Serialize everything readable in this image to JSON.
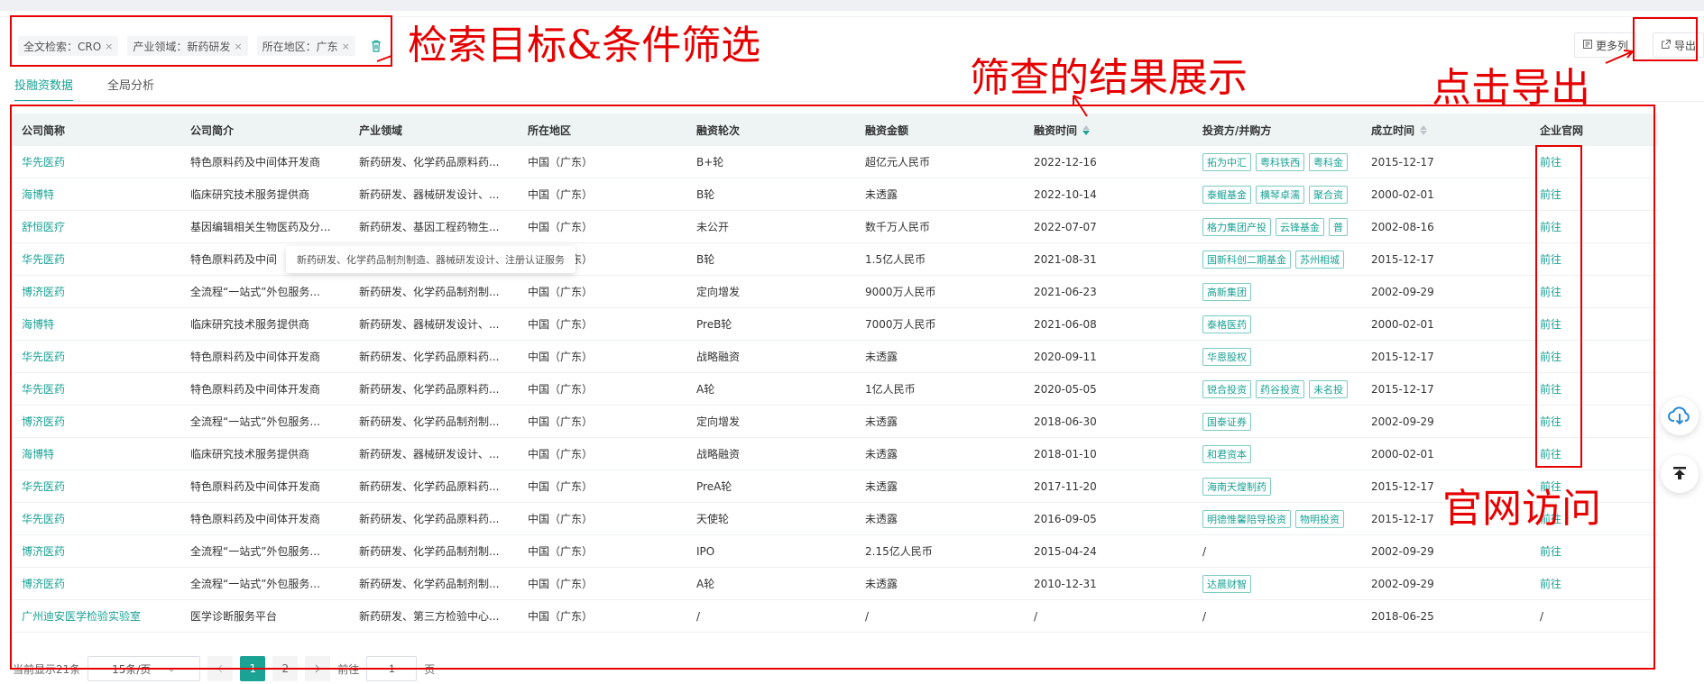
{
  "filters": [
    {
      "label": "全文检索：CRO"
    },
    {
      "label": "产业领域：新药研发"
    },
    {
      "label": "所在地区：广东"
    }
  ],
  "filter_close_glyph": "×",
  "toolbar": {
    "more_columns": "更多列",
    "export": "导出"
  },
  "tabs": [
    {
      "label": "投融资数据",
      "active": true
    },
    {
      "label": "全局分析",
      "active": false
    }
  ],
  "table": {
    "columns": [
      "公司简称",
      "公司简介",
      "产业领域",
      "所在地区",
      "融资轮次",
      "融资金额",
      "融资时间",
      "投资方/并购方",
      "成立时间",
      "企业官网"
    ],
    "rows": [
      {
        "name": "华先医药",
        "intro": "特色原料药及中间体开发商",
        "field": "新药研发、化学药品原料药...",
        "region": "中国（广东）",
        "round": "B+轮",
        "amount": "超亿元人民币",
        "date": "2022-12-16",
        "investors": [
          "拓为中汇",
          "粤科铁西",
          "粤科金"
        ],
        "founded": "2015-12-17",
        "site": "前往"
      },
      {
        "name": "海博特",
        "intro": "临床研究技术服务提供商",
        "field": "新药研发、器械研发设计、...",
        "region": "中国（广东）",
        "round": "B轮",
        "amount": "未透露",
        "date": "2022-10-14",
        "investors": [
          "泰鲲基金",
          "横琴卓濡",
          "聚合资"
        ],
        "founded": "2000-02-01",
        "site": "前往"
      },
      {
        "name": "舒恒医疗",
        "intro": "基因编辑相关生物医药及分...",
        "field": "新药研发、基因工程药物生...",
        "region": "中国（广东）",
        "round": "未公开",
        "amount": "数千万人民币",
        "date": "2022-07-07",
        "investors": [
          "格力集团产投",
          "云锋基金",
          "普"
        ],
        "founded": "2002-08-16",
        "site": "前往"
      },
      {
        "name": "华先医药",
        "intro": "特色原料药及中间",
        "field": "新药研发、化学药品原料药...",
        "region": "中国（广东）",
        "round": "B轮",
        "amount": "1.5亿人民币",
        "date": "2021-08-31",
        "investors": [
          "国新科创二期基金",
          "苏州相城"
        ],
        "founded": "2015-12-17",
        "site": "前往"
      },
      {
        "name": "博济医药",
        "intro": "全流程“一站式”外包服务...",
        "field": "新药研发、化学药品制剂制...",
        "region": "中国（广东）",
        "round": "定向增发",
        "amount": "9000万人民币",
        "date": "2021-06-23",
        "investors": [
          "高新集团"
        ],
        "founded": "2002-09-29",
        "site": "前往"
      },
      {
        "name": "海博特",
        "intro": "临床研究技术服务提供商",
        "field": "新药研发、器械研发设计、...",
        "region": "中国（广东）",
        "round": "PreB轮",
        "amount": "7000万人民币",
        "date": "2021-06-08",
        "investors": [
          "泰格医药"
        ],
        "founded": "2000-02-01",
        "site": "前往"
      },
      {
        "name": "华先医药",
        "intro": "特色原料药及中间体开发商",
        "field": "新药研发、化学药品原料药...",
        "region": "中国（广东）",
        "round": "战略融资",
        "amount": "未透露",
        "date": "2020-09-11",
        "investors": [
          "华恩股权"
        ],
        "founded": "2015-12-17",
        "site": "前往"
      },
      {
        "name": "华先医药",
        "intro": "特色原料药及中间体开发商",
        "field": "新药研发、化学药品原料药...",
        "region": "中国（广东）",
        "round": "A轮",
        "amount": "1亿人民币",
        "date": "2020-05-05",
        "investors": [
          "锐合投资",
          "药谷投资",
          "未名投"
        ],
        "founded": "2015-12-17",
        "site": "前往"
      },
      {
        "name": "博济医药",
        "intro": "全流程“一站式”外包服务...",
        "field": "新药研发、化学药品制剂制...",
        "region": "中国（广东）",
        "round": "定向增发",
        "amount": "未透露",
        "date": "2018-06-30",
        "investors": [
          "国泰证券"
        ],
        "founded": "2002-09-29",
        "site": "前往"
      },
      {
        "name": "海博特",
        "intro": "临床研究技术服务提供商",
        "field": "新药研发、器械研发设计、...",
        "region": "中国（广东）",
        "round": "战略融资",
        "amount": "未透露",
        "date": "2018-01-10",
        "investors": [
          "和君资本"
        ],
        "founded": "2000-02-01",
        "site": "前往"
      },
      {
        "name": "华先医药",
        "intro": "特色原料药及中间体开发商",
        "field": "新药研发、化学药品原料药...",
        "region": "中国（广东）",
        "round": "PreA轮",
        "amount": "未透露",
        "date": "2017-11-20",
        "investors": [
          "海南天煌制药"
        ],
        "founded": "2015-12-17",
        "site": "前往"
      },
      {
        "name": "华先医药",
        "intro": "特色原料药及中间体开发商",
        "field": "新药研发、化学药品原料药...",
        "region": "中国（广东）",
        "round": "天使轮",
        "amount": "未透露",
        "date": "2016-09-05",
        "investors": [
          "明德惟馨陪导投资",
          "物明投资"
        ],
        "founded": "2015-12-17",
        "site": "前往"
      },
      {
        "name": "博济医药",
        "intro": "全流程“一站式”外包服务...",
        "field": "新药研发、化学药品制剂制...",
        "region": "中国（广东）",
        "round": "IPO",
        "amount": "2.15亿人民币",
        "date": "2015-04-24",
        "investors": [],
        "investors_text": "/",
        "founded": "2002-09-29",
        "site": "前往"
      },
      {
        "name": "博济医药",
        "intro": "全流程“一站式”外包服务...",
        "field": "新药研发、化学药品制剂制...",
        "region": "中国（广东）",
        "round": "A轮",
        "amount": "未透露",
        "date": "2010-12-31",
        "investors": [
          "达晨财智"
        ],
        "founded": "2002-09-29",
        "site": "前往"
      },
      {
        "name": "广州迪安医学检验实验室",
        "intro": "医学诊断服务平台",
        "field": "新药研发、第三方检验中心...",
        "region": "中国（广东）",
        "round": "/",
        "amount": "/",
        "date": "/",
        "investors": [],
        "investors_text": "/",
        "founded": "2018-06-25",
        "site": "/"
      }
    ]
  },
  "tooltip": "新药研发、化学药品制剂制造、器械研发设计、注册认证服务",
  "pagination": {
    "total_text": "当前显示21条",
    "page_size": "15条/页",
    "pages": [
      "1",
      "2"
    ],
    "current": "1",
    "goto_label": "前往",
    "goto_value": "1",
    "page_suffix": "页"
  },
  "annotations": {
    "search": "检索目标&条件筛选",
    "results": "筛查的结果展示",
    "export": "点击导出",
    "website": "官网访问"
  },
  "colors": {
    "accent": "#1aa294",
    "annotation": "#e60000"
  }
}
